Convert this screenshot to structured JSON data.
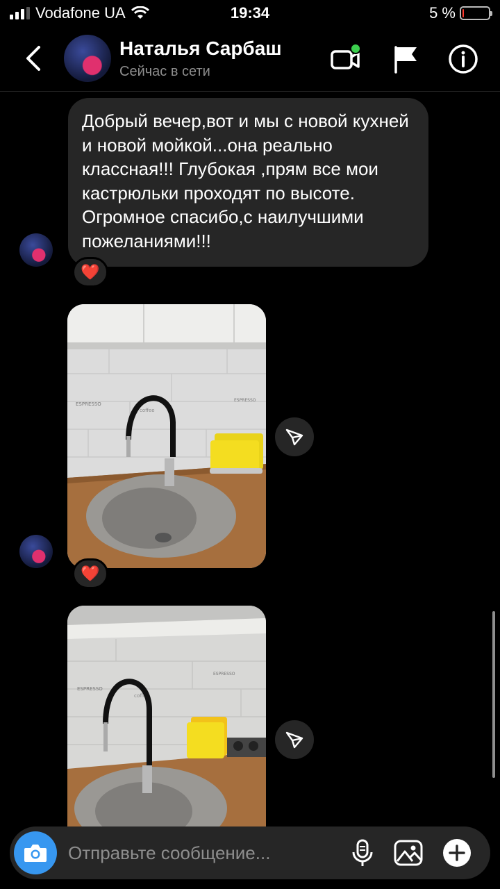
{
  "status_bar": {
    "carrier": "Vodafone UA",
    "time": "19:34",
    "battery_text": "5 %",
    "battery_level": 0.05
  },
  "header": {
    "contact_name": "Наталья Сарбаш",
    "presence": "Сейчас в сети",
    "icons": [
      "back-chevron-icon",
      "video-call-icon",
      "flag-icon",
      "info-icon"
    ],
    "online_color": "#3ccf4e"
  },
  "messages": [
    {
      "type": "text",
      "text": "Добрый вечер,вот и мы с новой кухней и новой мойкой...она реально классная!!! Глубокая ,прям все мои кастрюльки проходят по высоте. Огромное спасибо,с наилучшими пожеланиями!!!",
      "reaction": "❤️"
    },
    {
      "type": "photo",
      "reaction": "❤️",
      "tile_label": "ESPRESSO",
      "tile_sub": "coffee"
    },
    {
      "type": "photo",
      "reaction": null,
      "tile_label": "ESPRESSO",
      "tile_sub": "coffee"
    }
  ],
  "composer": {
    "placeholder": "Отправьте сообщение...",
    "icons": [
      "camera-icon",
      "microphone-icon",
      "gallery-icon",
      "add-icon"
    ],
    "camera_color": "#3797f0"
  },
  "theme": {
    "background": "#000000",
    "bubble": "#262626",
    "secondary_text": "#8e8e8e",
    "reaction_heart": "#ff2d4a"
  }
}
